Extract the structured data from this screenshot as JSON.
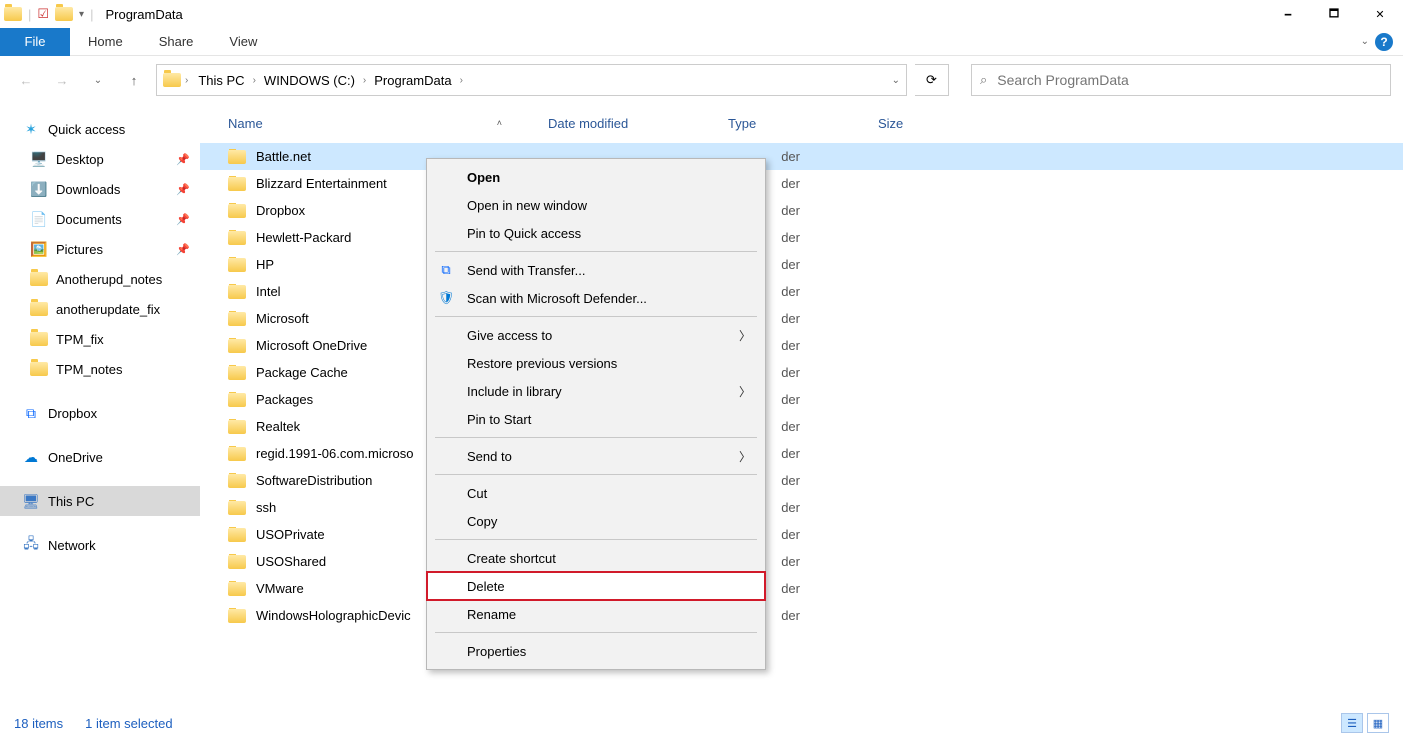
{
  "window": {
    "title": "ProgramData",
    "minimize": "🗕",
    "maximize": "🗖",
    "close": "✕"
  },
  "ribbon": {
    "file": "File",
    "tabs": [
      "Home",
      "Share",
      "View"
    ],
    "help_chevron": "⌄",
    "help": "?"
  },
  "nav": {
    "back": "←",
    "forward": "→",
    "recent_chevron": "⌄",
    "up": "↑",
    "refresh": "⟳",
    "addr_dropdown": "⌄"
  },
  "breadcrumbs": [
    "This PC",
    "WINDOWS (C:)",
    "ProgramData"
  ],
  "search": {
    "placeholder": "Search ProgramData"
  },
  "sidebar": {
    "quick_access": "Quick access",
    "items_pinned": [
      {
        "label": "Desktop",
        "icon": "🖥️",
        "pin": true
      },
      {
        "label": "Downloads",
        "icon": "⬇️",
        "pin": true
      },
      {
        "label": "Documents",
        "icon": "📄",
        "pin": true
      },
      {
        "label": "Pictures",
        "icon": "🖼️",
        "pin": true
      }
    ],
    "items_recent": [
      {
        "label": "Anotherupd_notes"
      },
      {
        "label": "anotherupdate_fix"
      },
      {
        "label": "TPM_fix"
      },
      {
        "label": "TPM_notes"
      }
    ],
    "dropbox": "Dropbox",
    "onedrive": "OneDrive",
    "this_pc": "This PC",
    "network": "Network"
  },
  "columns": {
    "name": "Name",
    "date": "Date modified",
    "type": "Type",
    "size": "Size"
  },
  "files": [
    {
      "name": "Battle.net",
      "type": "File folder",
      "selected": true
    },
    {
      "name": "Blizzard Entertainment",
      "type": "File folder"
    },
    {
      "name": "Dropbox",
      "type": "File folder"
    },
    {
      "name": "Hewlett-Packard",
      "type": "File folder"
    },
    {
      "name": "HP",
      "type": "File folder"
    },
    {
      "name": "Intel",
      "type": "File folder"
    },
    {
      "name": "Microsoft",
      "type": "File folder"
    },
    {
      "name": "Microsoft OneDrive",
      "type": "File folder"
    },
    {
      "name": "Package Cache",
      "type": "File folder"
    },
    {
      "name": "Packages",
      "type": "File folder"
    },
    {
      "name": "Realtek",
      "type": "File folder"
    },
    {
      "name": "regid.1991-06.com.microso",
      "type": "File folder"
    },
    {
      "name": "SoftwareDistribution",
      "type": "File folder"
    },
    {
      "name": "ssh",
      "type": "File folder"
    },
    {
      "name": "USOPrivate",
      "type": "File folder"
    },
    {
      "name": "USOShared",
      "type": "File folder"
    },
    {
      "name": "VMware",
      "type": "File folder"
    },
    {
      "name": "WindowsHolographicDevic",
      "type": "File folder"
    }
  ],
  "context_menu": {
    "type_obscured": "der",
    "groups": [
      [
        {
          "label": "Open",
          "bold": true
        },
        {
          "label": "Open in new window"
        },
        {
          "label": "Pin to Quick access"
        }
      ],
      [
        {
          "label": "Send with Transfer...",
          "icon": "dropbox"
        },
        {
          "label": "Scan with Microsoft Defender...",
          "icon": "shield"
        }
      ],
      [
        {
          "label": "Give access to",
          "sub": true
        },
        {
          "label": "Restore previous versions"
        },
        {
          "label": "Include in library",
          "sub": true
        },
        {
          "label": "Pin to Start"
        }
      ],
      [
        {
          "label": "Send to",
          "sub": true
        }
      ],
      [
        {
          "label": "Cut"
        },
        {
          "label": "Copy"
        }
      ],
      [
        {
          "label": "Create shortcut"
        },
        {
          "label": "Delete",
          "highlight": true
        },
        {
          "label": "Rename"
        }
      ],
      [
        {
          "label": "Properties"
        }
      ]
    ]
  },
  "statusbar": {
    "items": "18 items",
    "selected": "1 item selected"
  }
}
